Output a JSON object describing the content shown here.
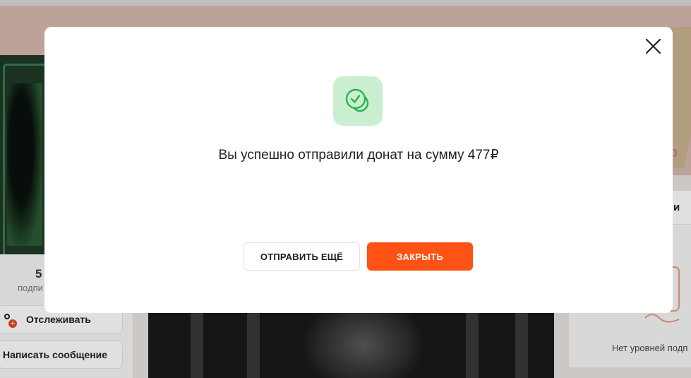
{
  "background": {
    "subscribers_count": "5",
    "subscribers_label": "подпи",
    "follow_label": "Отслеживать",
    "message_label": "Написать сообщение",
    "right_header": "ни",
    "no_levels_text": "Нет уровней подп",
    "cover_partial_text": "р"
  },
  "modal": {
    "message": "Вы успешно отправили донат на сумму 477₽",
    "send_again_label": "ОТПРАВИТЬ ЕЩЁ",
    "close_label": "ЗАКРЫТЬ",
    "icons": {
      "success": "coins-check-icon",
      "close": "close-icon"
    }
  },
  "colors": {
    "accent": "#ff5316",
    "success_bg": "#c9efd0",
    "success_icon": "#2bb24c"
  }
}
